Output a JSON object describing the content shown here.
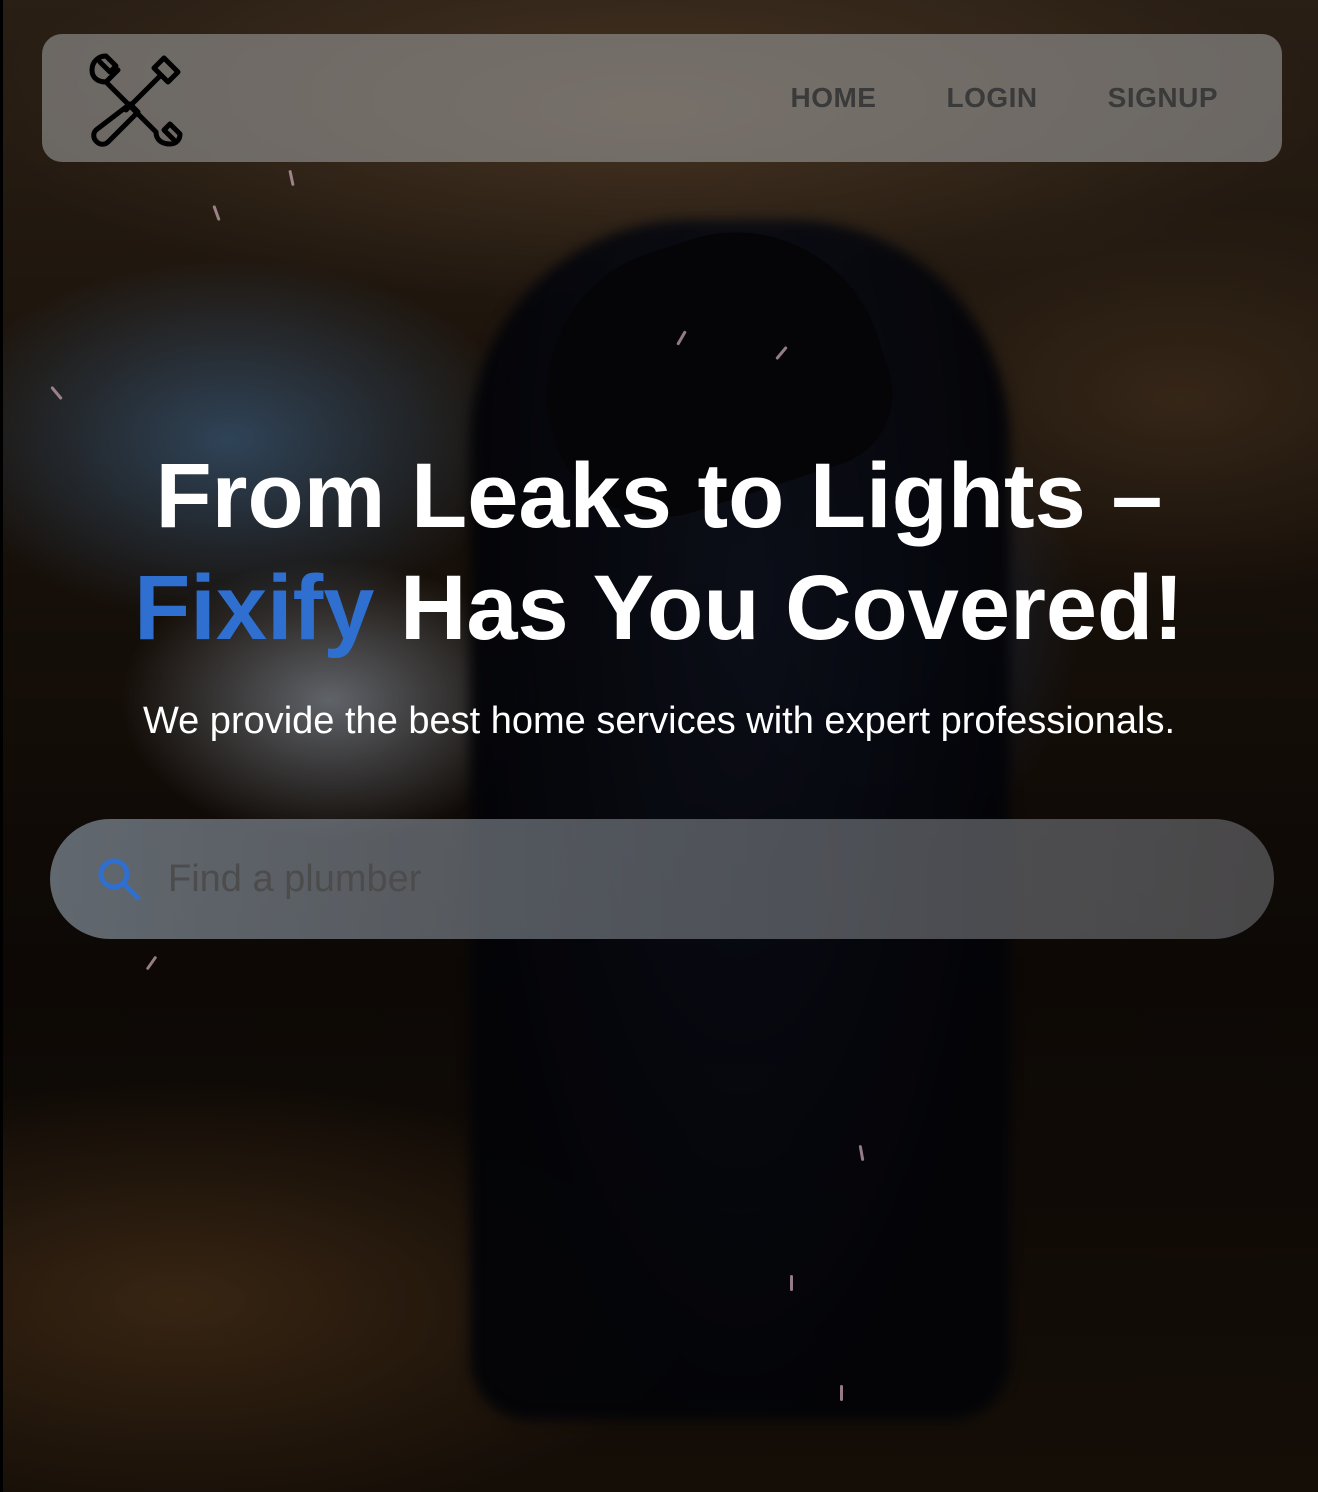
{
  "brand": {
    "logo_icon": "wrench-screwdriver-icon"
  },
  "nav": {
    "items": [
      {
        "label": "HOME"
      },
      {
        "label": "LOGIN"
      },
      {
        "label": "SIGNUP"
      }
    ]
  },
  "hero": {
    "headline_part1": "From Leaks to Lights –",
    "headline_brand": "Fixify",
    "headline_part2": "Has You Covered!",
    "subheadline": "We provide the best home services with expert professionals.",
    "background_image": "welder-sparks-photo"
  },
  "search": {
    "placeholder": "Find a plumber",
    "value": "",
    "icon": "search-icon"
  },
  "colors": {
    "accent": "#2f6fd0",
    "nav_text": "#3a3a3a",
    "hero_text": "#ffffff"
  }
}
